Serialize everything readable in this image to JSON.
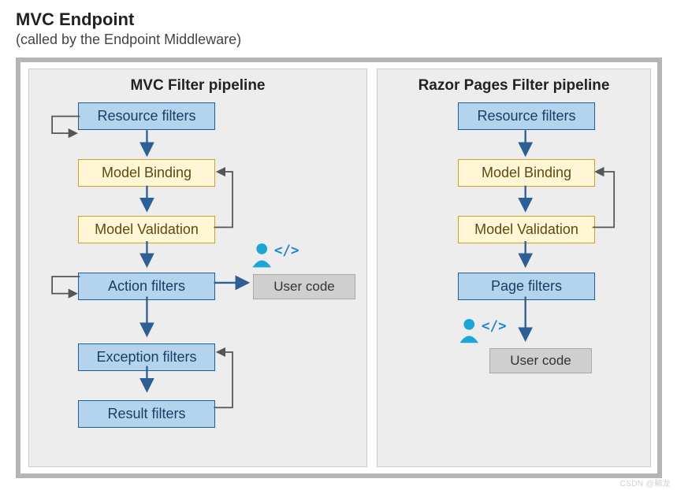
{
  "header": {
    "title": "MVC Endpoint",
    "subtitle": "(called by the Endpoint Middleware)"
  },
  "panels": {
    "left": {
      "title": "MVC Filter pipeline",
      "nodes": {
        "resource": "Resource filters",
        "binding": "Model Binding",
        "validation": "Model Validation",
        "action": "Action filters",
        "exception": "Exception filters",
        "result": "Result filters",
        "usercode": "User code"
      }
    },
    "right": {
      "title": "Razor Pages Filter pipeline",
      "nodes": {
        "resource": "Resource filters",
        "binding": "Model Binding",
        "validation": "Model Validation",
        "page": "Page filters",
        "usercode": "User code"
      }
    }
  },
  "watermark": "CSDN @頼龙"
}
